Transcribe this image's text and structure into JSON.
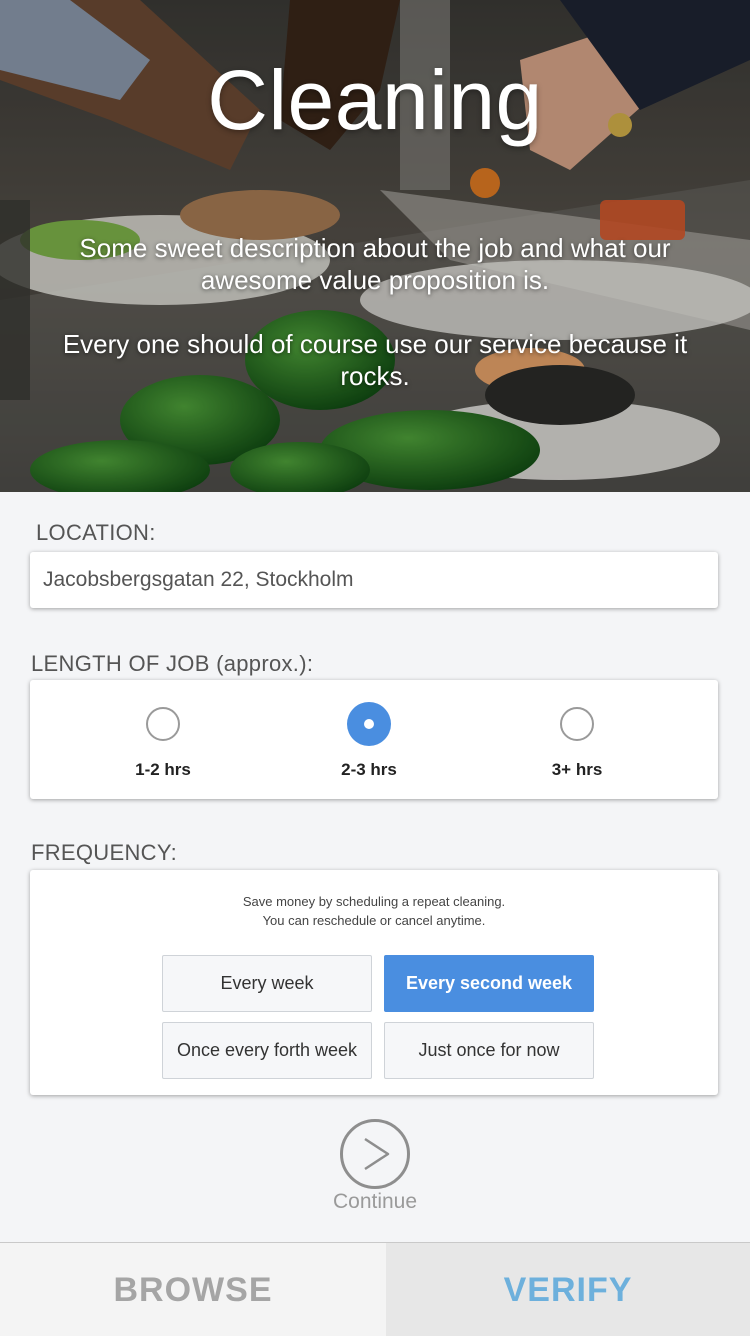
{
  "hero": {
    "title": "Cleaning",
    "description_1": "Some sweet description about the job and what our awesome value proposition is.",
    "description_2": "Every one should of course use our service because it rocks."
  },
  "location": {
    "label": "LOCATION:",
    "value": "Jacobsbergsgatan 22, Stockholm"
  },
  "length": {
    "label": "LENGTH OF JOB (approx.):",
    "options": [
      {
        "label": "1-2 hrs",
        "selected": false
      },
      {
        "label": "2-3 hrs",
        "selected": true
      },
      {
        "label": "3+ hrs",
        "selected": false
      }
    ]
  },
  "frequency": {
    "label": "FREQUENCY:",
    "hint_1": "Save money by scheduling a repeat cleaning.",
    "hint_2": "You can reschedule or cancel anytime.",
    "options": [
      {
        "label": "Every week",
        "selected": false
      },
      {
        "label": "Every second week",
        "selected": true
      },
      {
        "label": "Once every forth week",
        "selected": false
      },
      {
        "label": "Just once for now",
        "selected": false
      }
    ]
  },
  "continue": {
    "label": "Continue",
    "icon": "chevron-right-icon"
  },
  "tabs": {
    "browse": "BROWSE",
    "verify": "VERIFY"
  },
  "colors": {
    "accent": "#4a8ee0",
    "verify_tab": "#6db0dc",
    "browse_tab": "#a5a5a5"
  }
}
